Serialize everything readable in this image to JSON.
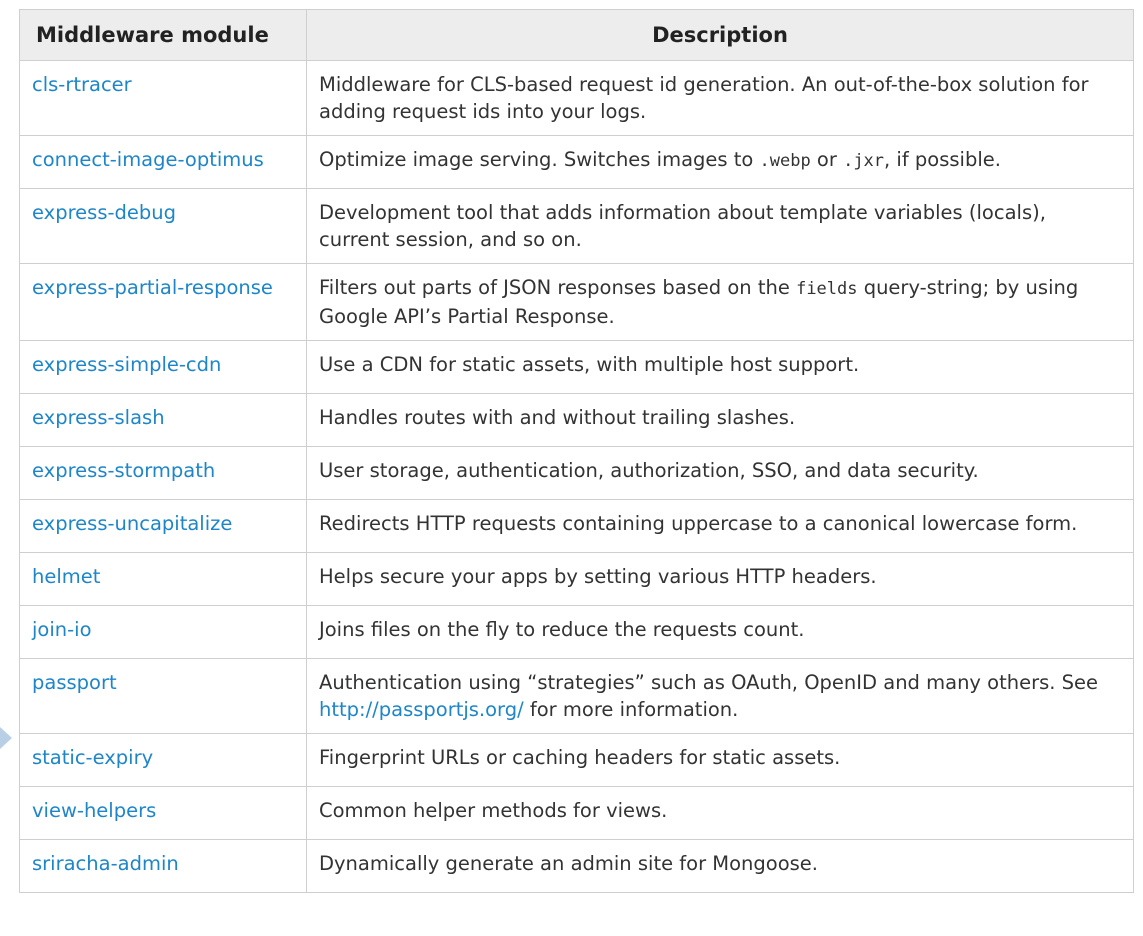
{
  "header": {
    "module": "Middleware module",
    "description": "Description"
  },
  "rows": [
    {
      "module": "cls-rtracer",
      "desc": [
        "Middleware for CLS-based request id generation. An out-of-the-box solution for adding request ids into your logs."
      ]
    },
    {
      "module": "connect-image-optimus",
      "desc_pre": "Optimize image serving. Switches images to ",
      "code1": ".webp",
      "mid": " or ",
      "code2": ".jxr",
      "desc_post": ", if possible."
    },
    {
      "module": "express-debug",
      "desc": [
        "Development tool that adds information about template variables (locals), current session, and so on."
      ]
    },
    {
      "module": "express-partial-response",
      "desc_pre": "Filters out parts of JSON responses based on the ",
      "code1": "fields",
      "desc_post": " query-string; by using Google API’s Partial Response."
    },
    {
      "module": "express-simple-cdn",
      "desc": [
        "Use a CDN for static assets, with multiple host support."
      ]
    },
    {
      "module": "express-slash",
      "desc": [
        "Handles routes with and without trailing slashes."
      ]
    },
    {
      "module": "express-stormpath",
      "desc": [
        "User storage, authentication, authorization, SSO, and data security."
      ]
    },
    {
      "module": "express-uncapitalize",
      "desc": [
        "Redirects HTTP requests containing uppercase to a canonical lowercase form."
      ]
    },
    {
      "module": "helmet",
      "desc": [
        "Helps secure your apps by setting various HTTP headers."
      ]
    },
    {
      "module": "join-io",
      "desc": [
        "Joins files on the fly to reduce the requests count."
      ]
    },
    {
      "module": "passport",
      "desc_pre": "Authentication using “strategies” such as OAuth, OpenID and many others. See ",
      "link": "http://passportjs.org/",
      "desc_post": " for more information."
    },
    {
      "module": "static-expiry",
      "desc": [
        "Fingerprint URLs or caching headers for static assets."
      ]
    },
    {
      "module": "view-helpers",
      "desc": [
        "Common helper methods for views."
      ]
    },
    {
      "module": "sriracha-admin",
      "desc": [
        "Dynamically generate an admin site for Mongoose."
      ]
    }
  ]
}
